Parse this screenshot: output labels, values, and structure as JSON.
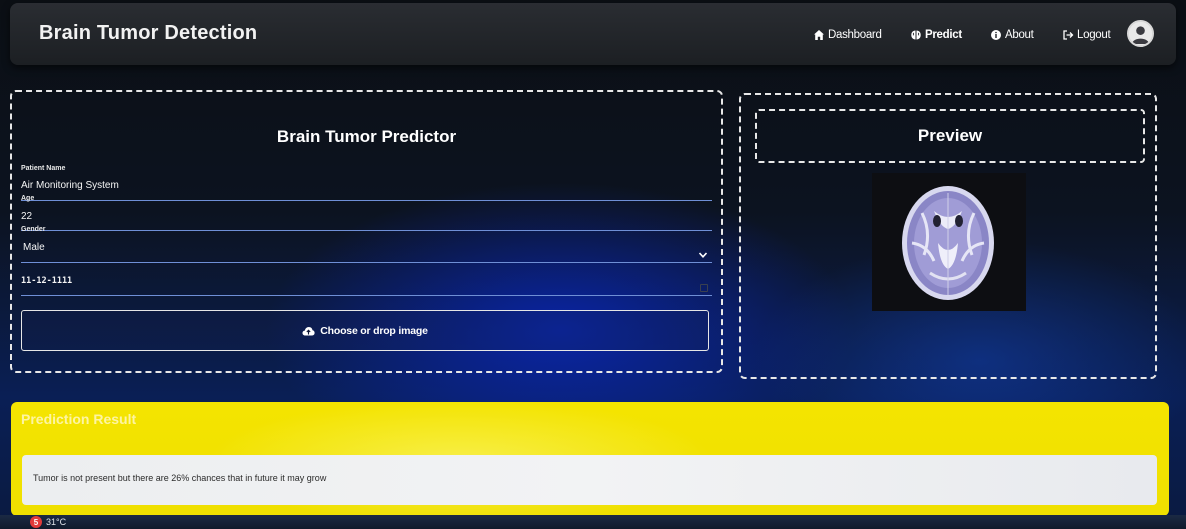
{
  "navbar": {
    "brand": "Brain Tumor Detection",
    "items": [
      {
        "label": "Dashboard",
        "icon": "home-icon"
      },
      {
        "label": "Predict",
        "icon": "brain-icon"
      },
      {
        "label": "About",
        "icon": "info-icon"
      },
      {
        "label": "Logout",
        "icon": "logout-icon"
      }
    ],
    "avatar_icon": "user-avatar-icon"
  },
  "form": {
    "title": "Brain Tumor Predictor",
    "patient_name": {
      "label": "Patient Name",
      "value": "Air Monitoring System"
    },
    "age": {
      "label": "Age",
      "value": "22"
    },
    "gender": {
      "label": "Gender",
      "value": "Male"
    },
    "date": {
      "value": "11-12-1111"
    },
    "upload_label": "Choose or drop image",
    "upload_icon": "cloud-upload-icon"
  },
  "preview": {
    "title": "Preview"
  },
  "result": {
    "title": "Prediction Result",
    "message": "Tumor is not present but there are 26% chances that in future it may grow"
  },
  "taskbar": {
    "badge": "5",
    "temperature": "31°C"
  },
  "colors": {
    "accent_line": "#6f8fd6",
    "result_bg": "#f4e400"
  }
}
